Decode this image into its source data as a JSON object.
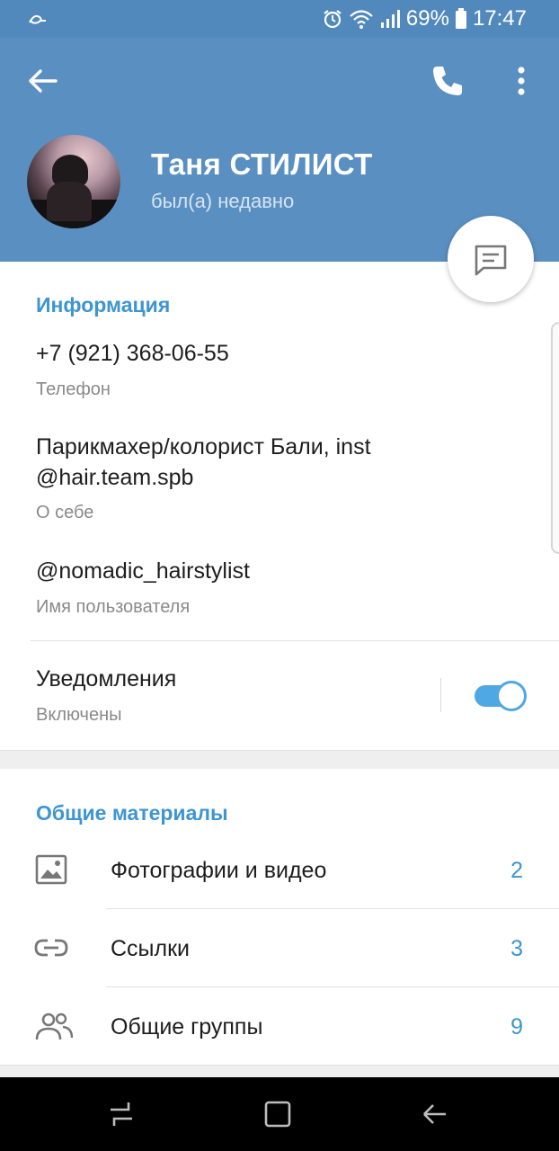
{
  "status_bar": {
    "battery_percent": "69%",
    "time": "17:47",
    "icons": [
      "app-notification-icon",
      "alarm-icon",
      "wifi-icon",
      "signal-icon",
      "battery-icon"
    ]
  },
  "header": {
    "name": "Таня СТИЛИСТ",
    "status": "был(а) недавно",
    "icons": [
      "back-arrow-icon",
      "phone-icon",
      "more-vertical-icon"
    ]
  },
  "fab": {
    "icon": "message-icon"
  },
  "info": {
    "section_title": "Информация",
    "phone": {
      "value": "+7 (921) 368-06-55",
      "label": "Телефон"
    },
    "bio": {
      "line1": "Парикмахер/колорист Бали, inst",
      "line2": "@hair.team.spb",
      "label": "О себе"
    },
    "username": {
      "value": "@nomadic_hairstylist",
      "label": "Имя пользователя"
    },
    "notifications": {
      "value": "Уведомления",
      "label": "Включены",
      "enabled": true
    }
  },
  "shared": {
    "section_title": "Общие материалы",
    "items": [
      {
        "label": "Фотографии и видео",
        "count": "2",
        "icon": "image-icon"
      },
      {
        "label": "Ссылки",
        "count": "3",
        "icon": "link-icon"
      },
      {
        "label": "Общие группы",
        "count": "9",
        "icon": "group-icon"
      }
    ]
  },
  "navbar": {
    "icons": [
      "recent-apps-icon",
      "home-icon",
      "back-icon"
    ]
  },
  "colors": {
    "header": "#5a8fc2",
    "status_bar": "#5289bc",
    "accent": "#3d95d2",
    "toggle": "#4fa7e3"
  }
}
